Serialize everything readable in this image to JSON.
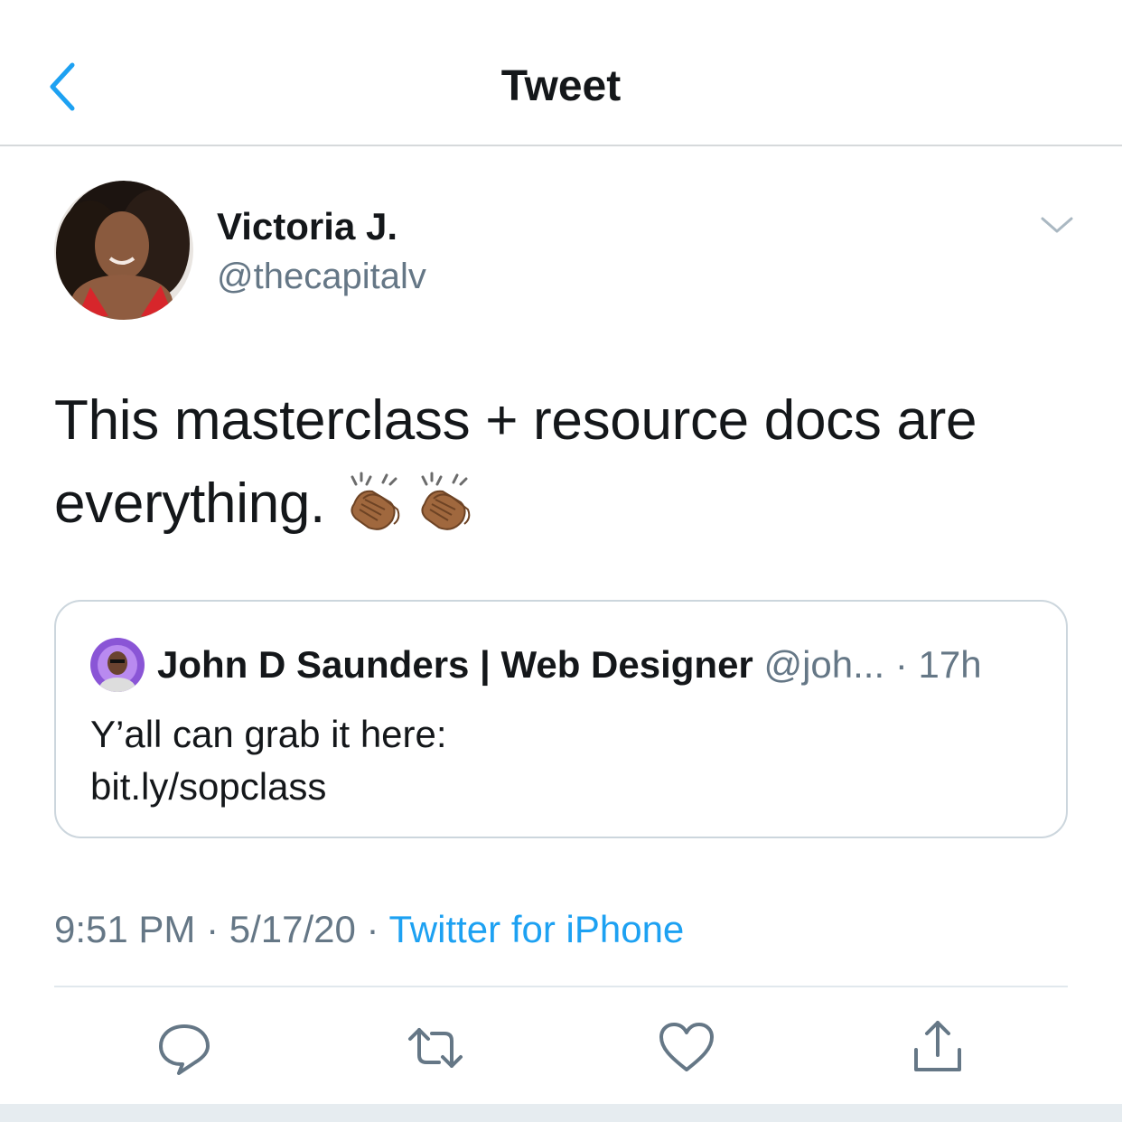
{
  "nav": {
    "title": "Tweet",
    "back_icon": "chevron-left-icon"
  },
  "tweet": {
    "author_name": "Victoria J.",
    "author_handle": "@thecapitalv",
    "text": "This masterclass + resource docs are everything.",
    "emoji": [
      "clapping-hands-medium-dark-skin",
      "clapping-hands-medium-dark-skin"
    ],
    "time": "9:51 PM",
    "date": "5/17/20",
    "source": "Twitter for iPhone",
    "separator": " · "
  },
  "quoted_tweet": {
    "author_name": "John D Saunders | Web Designer",
    "author_handle": "@joh...",
    "time": "17h",
    "dot": " · ",
    "line1": "Y’all can grab it here:",
    "line2": "bit.ly/sopclass"
  },
  "actions": [
    "reply-icon",
    "retweet-icon",
    "like-icon",
    "share-icon"
  ],
  "colors": {
    "accent": "#1da1f2",
    "text": "#14171a",
    "secondary": "#657786",
    "border": "#ccd6dd"
  }
}
